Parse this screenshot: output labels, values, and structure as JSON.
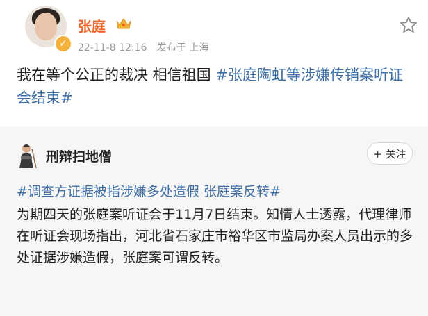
{
  "post": {
    "author": "张庭",
    "time": "22-11-8 12:16",
    "source": "发布于 上海",
    "text": "我在等个公正的裁决 相信祖国",
    "topic": "#张庭陶虹等涉嫌传销案听证会结束#"
  },
  "repost": {
    "author": "刑辩扫地僧",
    "follow_label": "+ 关注",
    "topic": "#调查方证据被指涉嫌多处造假 张庭案反转#",
    "text": "为期四天的张庭案听证会于11月7日结束。知情人士透露，代理律师在听证会现场指出，河北省石家庄市裕华区市监局办案人员出示的多处证据涉嫌造假，张庭案可谓反转。"
  },
  "colors": {
    "username": "#f26522",
    "topic": "#3f6fa7",
    "meta": "#999999",
    "verified_badge": "#f4b23c"
  },
  "icons": [
    "avatar",
    "verified-badge-icon",
    "crown-icon",
    "star-icon",
    "repost-avatar-icon"
  ]
}
